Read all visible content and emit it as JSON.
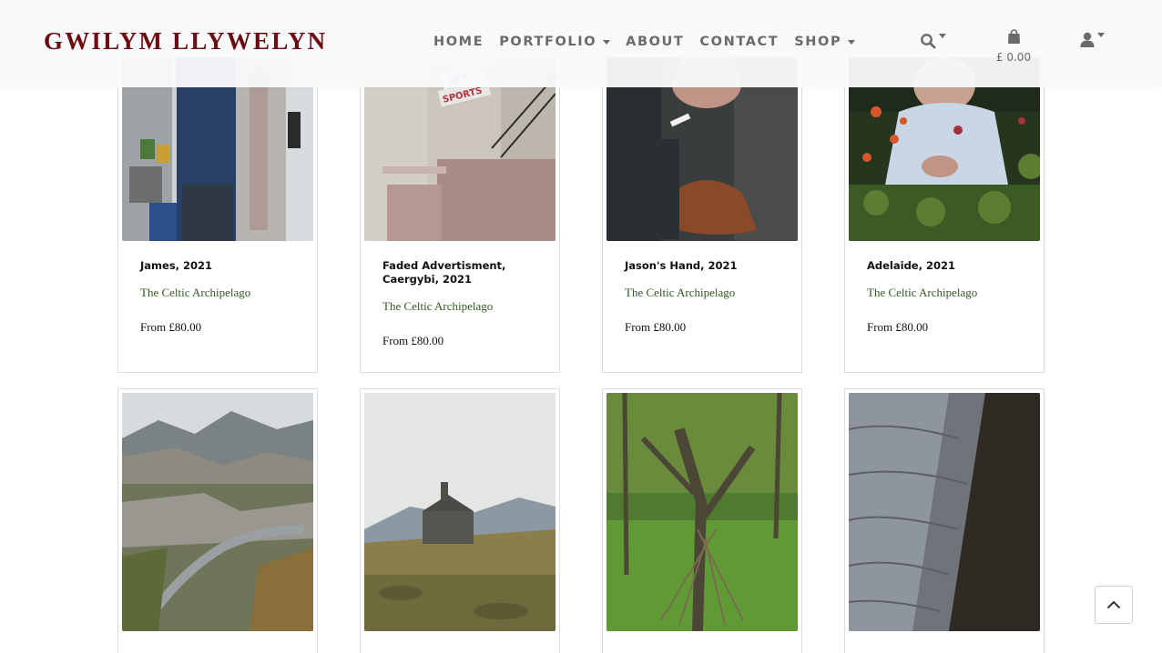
{
  "header": {
    "brand": "GWILYM LLYWELYN",
    "nav": [
      {
        "label": "HOME",
        "dropdown": false
      },
      {
        "label": "PORTFOLIO",
        "dropdown": true
      },
      {
        "label": "ABOUT",
        "dropdown": false
      },
      {
        "label": "CONTACT",
        "dropdown": false
      },
      {
        "label": "SHOP",
        "dropdown": true
      }
    ],
    "cart_amount": "£ 0.00",
    "icons": {
      "search": "search-icon",
      "cart": "shopping-bag-icon",
      "account": "user-icon"
    }
  },
  "products_row1": [
    {
      "title": "James, 2021",
      "collection": "The Celtic Archipelago",
      "price": "From £80.00"
    },
    {
      "title": "Faded Advertisment, Caergybi, 2021",
      "collection": "The Celtic Archipelago",
      "price": "From £80.00",
      "sign": "SKY SPORTS"
    },
    {
      "title": "Jason's Hand, 2021",
      "collection": "The Celtic Archipelago",
      "price": "From £80.00"
    },
    {
      "title": "Adelaide, 2021",
      "collection": "The Celtic Archipelago",
      "price": "From £80.00"
    }
  ],
  "products_row2": [
    {
      "image": "slate quarry valley landscape"
    },
    {
      "image": "ruined stone cottage on hillside"
    },
    {
      "image": "old tree with stick shelter in forest"
    },
    {
      "image": "textured slate rock face"
    }
  ],
  "colors": {
    "brand": "#6b0d12",
    "nav": "#6a6a6a",
    "collection": "#2f5a1f"
  },
  "scroll_top_icon": "chevron-up-icon"
}
